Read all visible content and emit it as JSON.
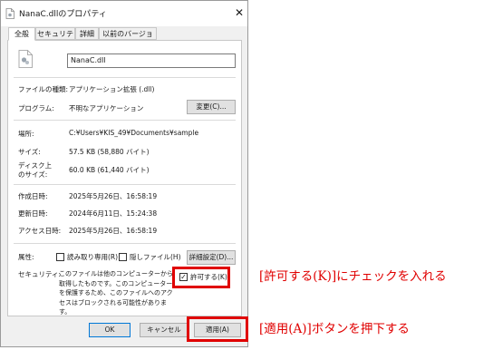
{
  "window": {
    "title": "NanaC.dllのプロパティ",
    "close_glyph": "✕"
  },
  "tabs": [
    {
      "label": "全般"
    },
    {
      "label": "セキュリティ"
    },
    {
      "label": "詳細"
    },
    {
      "label": "以前のバージョン"
    }
  ],
  "general": {
    "file_name": "NanaC.dll",
    "file_type_label": "ファイルの種類:",
    "file_type_value": "アプリケーション拡張 (.dll)",
    "program_label": "プログラム:",
    "program_value": "不明なアプリケーション",
    "change_button": "変更(C)...",
    "location_label": "場所:",
    "location_value": "C:¥Users¥KIS_49¥Documents¥sample",
    "size_label": "サイズ:",
    "size_value": "57.5 KB (58,880 バイト)",
    "disk_label_line1": "ディスク上",
    "disk_label_line2": "のサイズ:",
    "disk_value": "60.0 KB (61,440 バイト)",
    "created_label": "作成日時:",
    "created_value": "2025年5月26日、16:58:19",
    "modified_label": "更新日時:",
    "modified_value": "2024年6月11日、15:24:38",
    "accessed_label": "アクセス日時:",
    "accessed_value": "2025年5月26日、16:58:19",
    "attributes_label": "属性:",
    "readonly_label": "読み取り専用(R)",
    "hidden_label": "隠しファイル(H)",
    "advanced_button": "詳細設定(D)...",
    "security_label": "セキュリティ:",
    "security_text": "このファイルは他のコンピューターから取得したものです。このコンピューターを保護するため、このファイルへのアクセスはブロックされる可能性があります。",
    "unblock_label": "許可する(K)",
    "unblock_checked": true,
    "check_glyph": "✓"
  },
  "footer": {
    "ok_button": "OK",
    "cancel_button": "キャンセル",
    "apply_button": "適用(A)"
  },
  "annotations": {
    "unblock_instruction": "[許可する(K)]にチェックを入れる",
    "apply_instruction": "[適用(A)]ボタンを押下する",
    "highlight_color": "#e00000"
  }
}
